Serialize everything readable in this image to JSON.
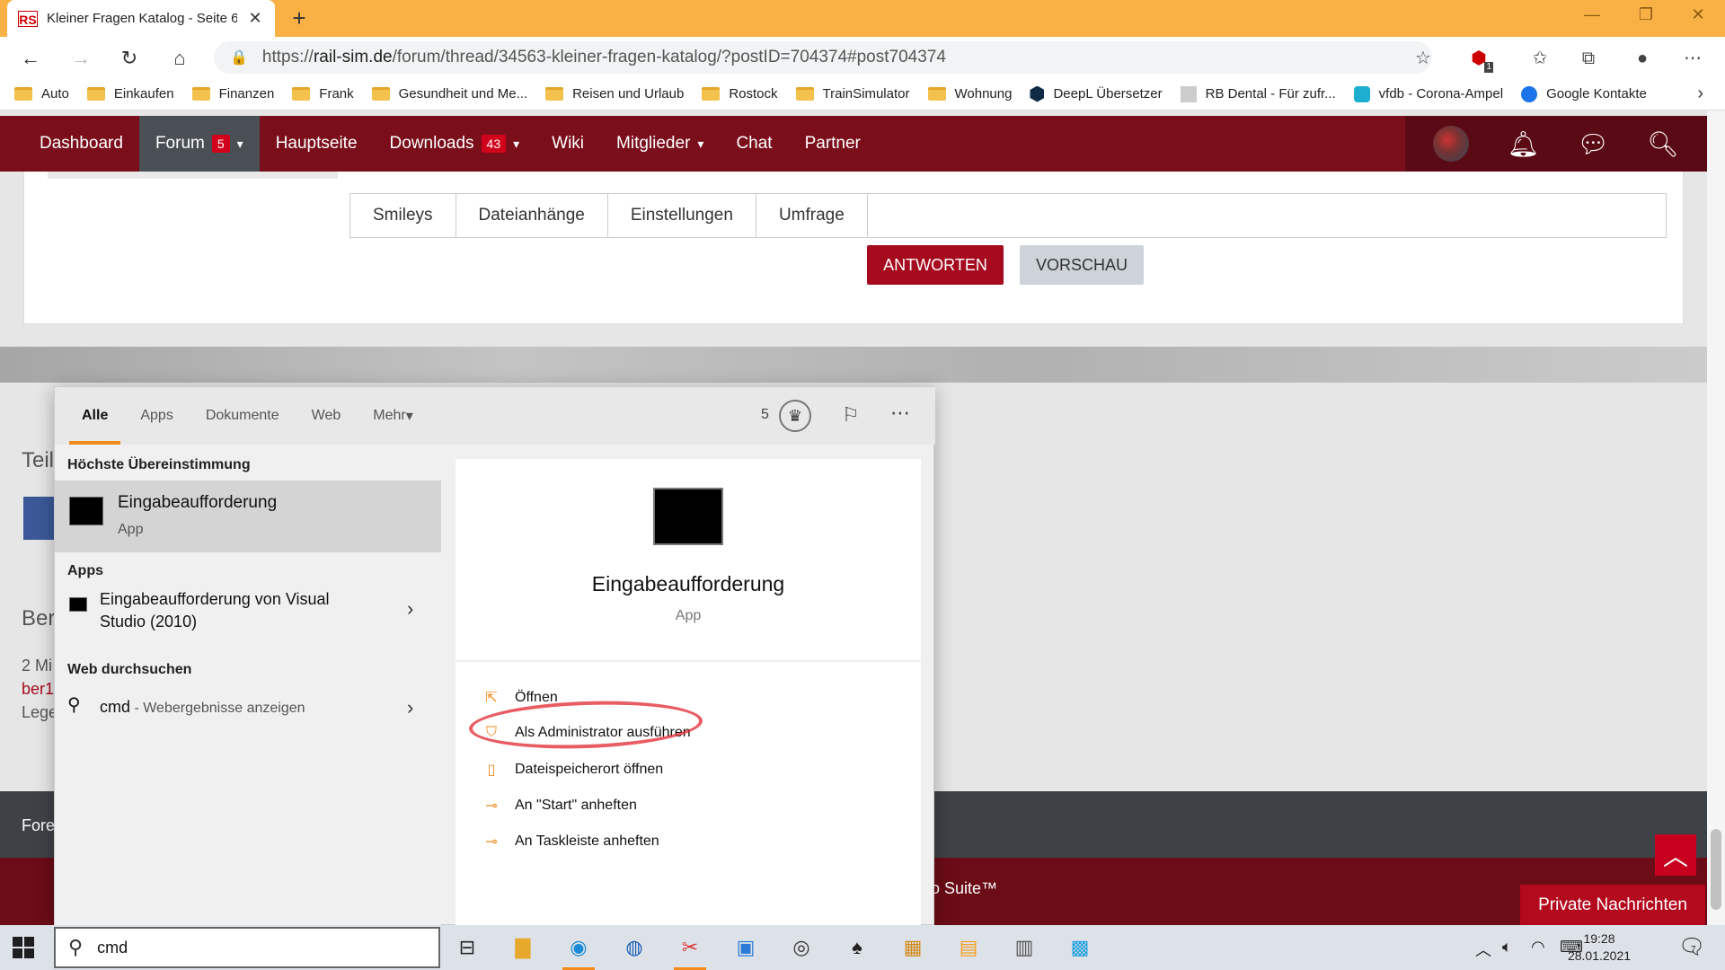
{
  "browser": {
    "tab_title": "Kleiner Fragen Katalog - Seite 6",
    "favicon": "RS",
    "url_prefix": "https://",
    "url_host": "rail-sim.de",
    "url_path": "/forum/thread/34563-kleiner-fragen-katalog/?postID=704374#post704374",
    "adblock_badge": "1"
  },
  "bookmarks": [
    {
      "label": "Auto",
      "icon": "folder"
    },
    {
      "label": "Einkaufen",
      "icon": "folder"
    },
    {
      "label": "Finanzen",
      "icon": "folder"
    },
    {
      "label": "Frank",
      "icon": "folder"
    },
    {
      "label": "Gesundheit und Me...",
      "icon": "folder"
    },
    {
      "label": "Reisen und Urlaub",
      "icon": "folder"
    },
    {
      "label": "Rostock",
      "icon": "folder"
    },
    {
      "label": "TrainSimulator",
      "icon": "folder"
    },
    {
      "label": "Wohnung",
      "icon": "folder"
    },
    {
      "label": "DeepL Übersetzer",
      "icon": "deepl"
    },
    {
      "label": "RB Dental - Für zufr...",
      "icon": "rb"
    },
    {
      "label": "vfdb - Corona-Ampel",
      "icon": "vfdb"
    },
    {
      "label": "Google Kontakte",
      "icon": "round"
    }
  ],
  "site_nav": {
    "items": [
      {
        "label": "Dashboard"
      },
      {
        "label": "Forum",
        "badge": "5",
        "dropdown": true,
        "active": true
      },
      {
        "label": "Hauptseite"
      },
      {
        "label": "Downloads",
        "badge": "43",
        "dropdown": true
      },
      {
        "label": "Wiki"
      },
      {
        "label": "Mitglieder",
        "dropdown": true
      },
      {
        "label": "Chat"
      },
      {
        "label": "Partner"
      }
    ]
  },
  "editor": {
    "tabs": [
      "Smileys",
      "Dateianhänge",
      "Einstellungen",
      "Umfrage"
    ],
    "answer_label": "ANTWORTEN",
    "preview_label": "VORSCHAU"
  },
  "page_partial": {
    "teilen": "Teil",
    "ber": "Ber",
    "line1": "2 Mi",
    "line2": "ber1",
    "line3": "Lege",
    "footer_left": "Fore",
    "footer_suite": "o Suite™",
    "pm_label": "Private Nachrichten"
  },
  "search_panel": {
    "tabs": [
      "Alle",
      "Apps",
      "Dokumente",
      "Web",
      "Mehr"
    ],
    "points": "5",
    "best_match_heading": "Höchste Übereinstimmung",
    "best_match_title": "Eingabeaufforderung",
    "best_match_sub": "App",
    "apps_heading": "Apps",
    "apps_item": "Eingabeaufforderung von Visual Studio (2010)",
    "web_heading": "Web durchsuchen",
    "web_query": "cmd",
    "web_sub": " - Webergebnisse anzeigen",
    "detail_title": "Eingabeaufforderung",
    "detail_sub": "App",
    "actions": [
      {
        "label": "Öffnen",
        "icon": "open-icon"
      },
      {
        "label": "Als Administrator ausführen",
        "icon": "shield-icon"
      },
      {
        "label": "Dateispeicherort öffnen",
        "icon": "file-location-icon"
      },
      {
        "label": "An \"Start\" anheften",
        "icon": "pin-icon"
      },
      {
        "label": "An Taskleiste anheften",
        "icon": "pin-icon"
      }
    ]
  },
  "taskbar": {
    "search_value": "cmd",
    "time": "19:28",
    "date": "28.01.2021",
    "notif_count": "7"
  },
  "colors": {
    "site_red": "#7a0e1b",
    "button_red": "#a60a1e",
    "accent_orange": "#f28b1b",
    "tabbar_orange": "#f9b045"
  }
}
